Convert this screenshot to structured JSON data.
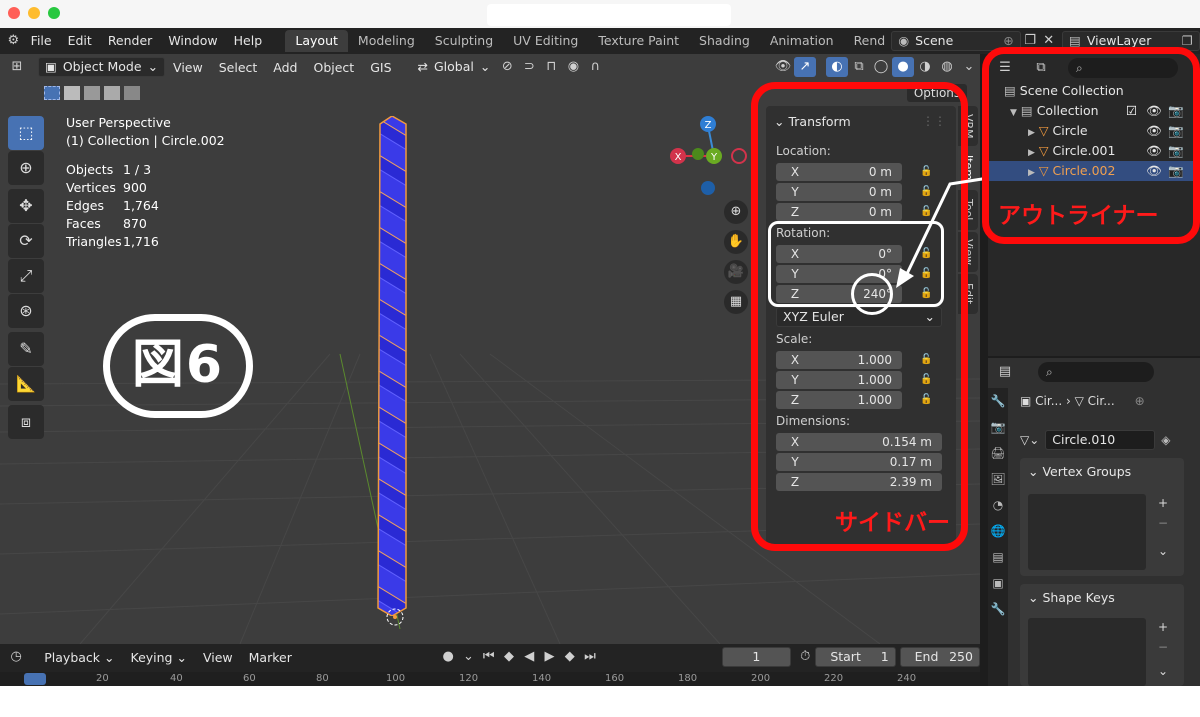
{
  "topbar": {
    "menus": [
      "File",
      "Edit",
      "Render",
      "Window",
      "Help"
    ],
    "workspaces": [
      "Layout",
      "Modeling",
      "Sculpting",
      "UV Editing",
      "Texture Paint",
      "Shading",
      "Animation",
      "Rend"
    ],
    "scene_name": "Scene",
    "view_layer": "ViewLayer"
  },
  "viewport": {
    "mode": "Object Mode",
    "menus": [
      "View",
      "Select",
      "Add",
      "Object",
      "GIS"
    ],
    "transform_orientation": "Global",
    "info": {
      "line1": "User Perspective",
      "line2": "(1) Collection | Circle.002"
    },
    "stats": [
      {
        "k": "Objects",
        "v": "1 / 3"
      },
      {
        "k": "Vertices",
        "v": "900"
      },
      {
        "k": "Edges",
        "v": "1,764"
      },
      {
        "k": "Faces",
        "v": "870"
      },
      {
        "k": "Triangles",
        "v": "1,716"
      }
    ],
    "figure_label": "図6",
    "options_label": "Options",
    "gizmo": {
      "x": "X",
      "y": "Y",
      "z": "Z"
    }
  },
  "sidebar": {
    "panel_title": "Transform",
    "location_label": "Location:",
    "location": [
      {
        "ax": "X",
        "v": "0 m"
      },
      {
        "ax": "Y",
        "v": "0 m"
      },
      {
        "ax": "Z",
        "v": "0 m"
      }
    ],
    "rotation_label": "Rotation:",
    "rotation": [
      {
        "ax": "X",
        "v": "0°"
      },
      {
        "ax": "Y",
        "v": "0°"
      },
      {
        "ax": "Z",
        "v": "240°"
      }
    ],
    "rotation_mode": "XYZ Euler",
    "scale_label": "Scale:",
    "scale": [
      {
        "ax": "X",
        "v": "1.000"
      },
      {
        "ax": "Y",
        "v": "1.000"
      },
      {
        "ax": "Z",
        "v": "1.000"
      }
    ],
    "dimensions_label": "Dimensions:",
    "dimensions": [
      {
        "ax": "X",
        "v": "0.154 m"
      },
      {
        "ax": "Y",
        "v": "0.17 m"
      },
      {
        "ax": "Z",
        "v": "2.39 m"
      }
    ],
    "tabs": [
      "VRM",
      "Item",
      "Tool",
      "View",
      "Edit"
    ]
  },
  "annotations": {
    "sidebar_label": "サイドバー",
    "outliner_label": "アウトライナー"
  },
  "outliner": {
    "scene_collection": "Scene Collection",
    "collection": "Collection",
    "objects": [
      "Circle",
      "Circle.001",
      "Circle.002"
    ]
  },
  "properties": {
    "breadcrumb_a": "Cir...",
    "breadcrumb_b": "Cir...",
    "mesh_name": "Circle.010",
    "vertex_groups": "Vertex Groups",
    "shape_keys": "Shape Keys"
  },
  "timeline": {
    "menus": [
      "Playback",
      "Keying",
      "View",
      "Marker"
    ],
    "current_frame": "1",
    "start_label": "Start",
    "start": "1",
    "end_label": "End",
    "end": "250",
    "ruler": [
      "20",
      "40",
      "60",
      "80",
      "100",
      "120",
      "140",
      "160",
      "180",
      "200",
      "220",
      "240"
    ]
  },
  "colors": {
    "accent": "#4772b3",
    "annotation_red": "#ff0a0a",
    "object_blue": "#3a3ae8",
    "selection": "#f09a3e"
  }
}
